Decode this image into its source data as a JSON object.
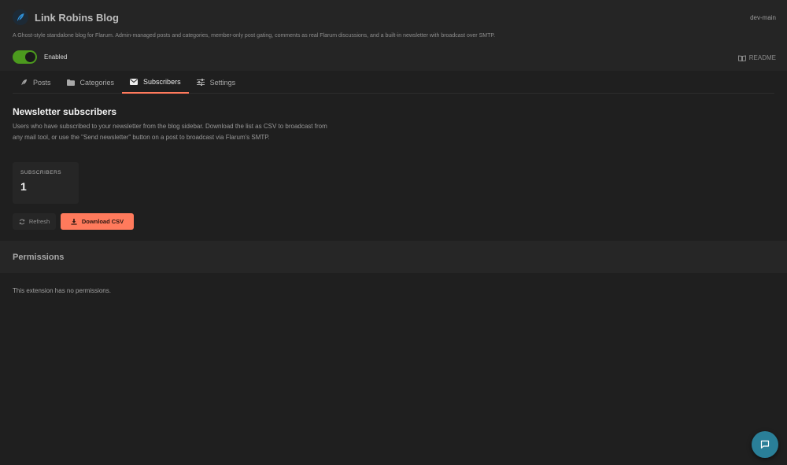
{
  "extension": {
    "title": "Link Robins Blog",
    "version": "dev-main",
    "description": "A Ghost-style standalone blog for Flarum. Admin-managed posts and categories, member-only post gating, comments as real Flarum discussions, and a built-in newsletter with broadcast over SMTP.",
    "enabled_label": "Enabled",
    "enabled": true,
    "readme_label": "README"
  },
  "tabs": [
    {
      "label": "Posts",
      "icon": "feather-icon"
    },
    {
      "label": "Categories",
      "icon": "folder-icon"
    },
    {
      "label": "Subscribers",
      "icon": "envelope-icon",
      "active": true
    },
    {
      "label": "Settings",
      "icon": "sliders-icon"
    }
  ],
  "subscribers": {
    "title": "Newsletter subscribers",
    "description": "Users who have subscribed to your newsletter from the blog sidebar. Download the list as CSV to broadcast from any mail tool, or use the \"Send newsletter\" button on a post to broadcast via Flarum's SMTP.",
    "stat_label": "SUBSCRIBERS",
    "stat_value": "1",
    "refresh_label": "Refresh",
    "download_label": "Download CSV"
  },
  "permissions": {
    "title": "Permissions",
    "note": "This extension has no permissions."
  },
  "colors": {
    "accent": "#ff7a5c",
    "toggle_on": "#4c9a1e",
    "chat": "#2a7f98"
  }
}
